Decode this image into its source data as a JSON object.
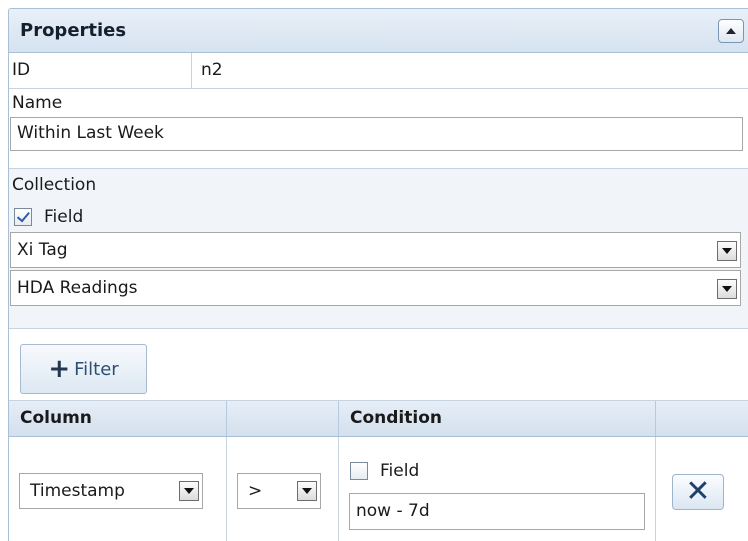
{
  "panel": {
    "title": "Properties"
  },
  "id_row": {
    "label": "ID",
    "value": "n2"
  },
  "name_section": {
    "label": "Name",
    "value": "Within Last Week"
  },
  "collection": {
    "label": "Collection",
    "field_checkbox_label": "Field",
    "field_checked": true,
    "select1": "Xi Tag",
    "select2": "HDA Readings"
  },
  "filter_button": {
    "label": "Filter",
    "icon": "plus-icon"
  },
  "grid": {
    "headers": [
      "Column",
      "",
      "Condition",
      ""
    ],
    "row": {
      "column_value": "Timestamp",
      "operator": ">",
      "condition_field_label": "Field",
      "condition_field_checked": false,
      "condition_value": "now - 7d",
      "delete_icon": "x-icon"
    }
  }
}
